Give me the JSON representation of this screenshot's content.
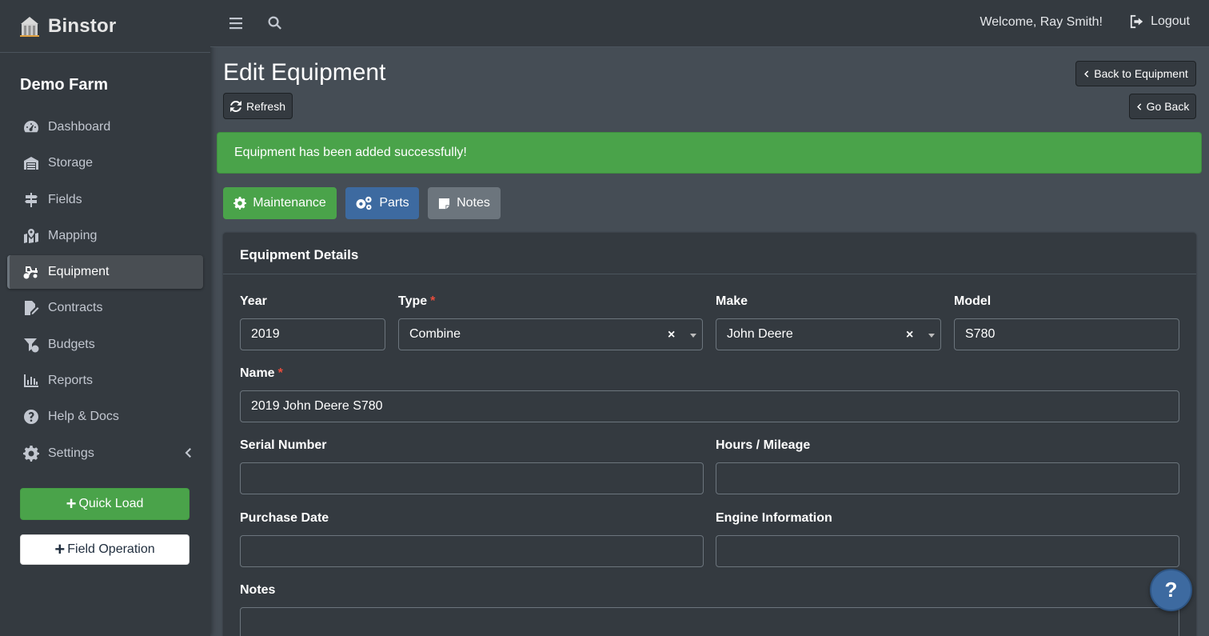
{
  "app": {
    "name": "Binstor",
    "farm": "Demo Farm"
  },
  "sidebar": {
    "items": [
      {
        "label": "Dashboard",
        "icon": "tachometer-icon"
      },
      {
        "label": "Storage",
        "icon": "warehouse-icon"
      },
      {
        "label": "Fields",
        "icon": "signs-icon"
      },
      {
        "label": "Mapping",
        "icon": "map-icon"
      },
      {
        "label": "Equipment",
        "icon": "tractor-icon",
        "active": true
      },
      {
        "label": "Contracts",
        "icon": "contract-icon"
      },
      {
        "label": "Budgets",
        "icon": "funnel-dollar-icon"
      },
      {
        "label": "Reports",
        "icon": "chart-icon"
      },
      {
        "label": "Help & Docs",
        "icon": "question-circle-icon"
      },
      {
        "label": "Settings",
        "icon": "gear-icon"
      }
    ],
    "quick_load": "Quick Load",
    "field_operation": "Field Operation"
  },
  "topbar": {
    "welcome": "Welcome, Ray Smith!",
    "logout": "Logout"
  },
  "page": {
    "title": "Edit Equipment",
    "refresh": "Refresh",
    "back_to_equipment": "Back to Equipment",
    "go_back": "Go Back",
    "alert": "Equipment has been added successfully!"
  },
  "tabs": {
    "maintenance": "Maintenance",
    "parts": "Parts",
    "notes": "Notes"
  },
  "form": {
    "header": "Equipment Details",
    "year_label": "Year",
    "year_value": "2019",
    "type_label": "Type",
    "type_value": "Combine",
    "make_label": "Make",
    "make_value": "John Deere",
    "model_label": "Model",
    "model_value": "S780",
    "name_label": "Name",
    "name_value": "2019 John Deere S780",
    "serial_label": "Serial Number",
    "serial_value": "",
    "hours_label": "Hours / Mileage",
    "hours_value": "",
    "purchase_label": "Purchase Date",
    "purchase_value": "",
    "engine_label": "Engine Information",
    "engine_value": "",
    "notes_label": "Notes",
    "notes_value": "",
    "required_mark": "*",
    "clear_mark": "×"
  },
  "help_fab": "?",
  "colors": {
    "success": "#4aa34a",
    "primary_tab": "#3d6aa0",
    "secondary_tab": "#6c757d",
    "sidebar_bg": "#343a40",
    "content_bg": "#454d55"
  }
}
